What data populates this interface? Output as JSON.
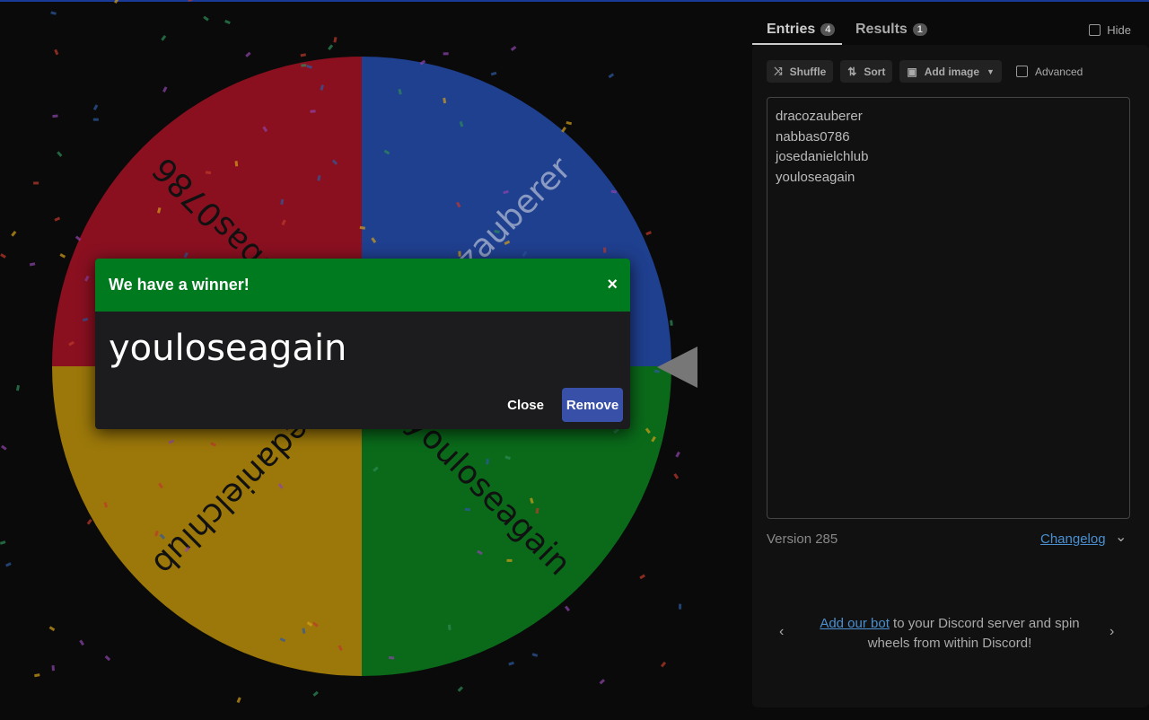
{
  "wheel": {
    "segments": [
      {
        "label": "dracozauberer",
        "color": "#1f3f8f"
      },
      {
        "label": "youloseagain",
        "color": "#0a6a1a"
      },
      {
        "label": "josedanielchlub",
        "color": "#9c780a"
      },
      {
        "label": "nabbas0786",
        "color": "#8a1020"
      }
    ]
  },
  "dialog": {
    "title": "We have a winner!",
    "close_icon": "×",
    "winner": "youloseagain",
    "close_label": "Close",
    "remove_label": "Remove"
  },
  "sidebar": {
    "tabs": [
      {
        "label": "Entries",
        "count": "4"
      },
      {
        "label": "Results",
        "count": "1"
      }
    ],
    "hide_label": "Hide",
    "toolbar": {
      "shuffle": "Shuffle",
      "sort": "Sort",
      "add_image": "Add image",
      "advanced": "Advanced"
    },
    "entries": [
      "dracozauberer",
      "nabbas0786",
      "josedanielchlub",
      "youloseagain"
    ],
    "version": "Version 285",
    "changelog": "Changelog",
    "promo": {
      "link": "Add our bot",
      "text": " to your Discord server and spin wheels from within Discord!"
    }
  }
}
